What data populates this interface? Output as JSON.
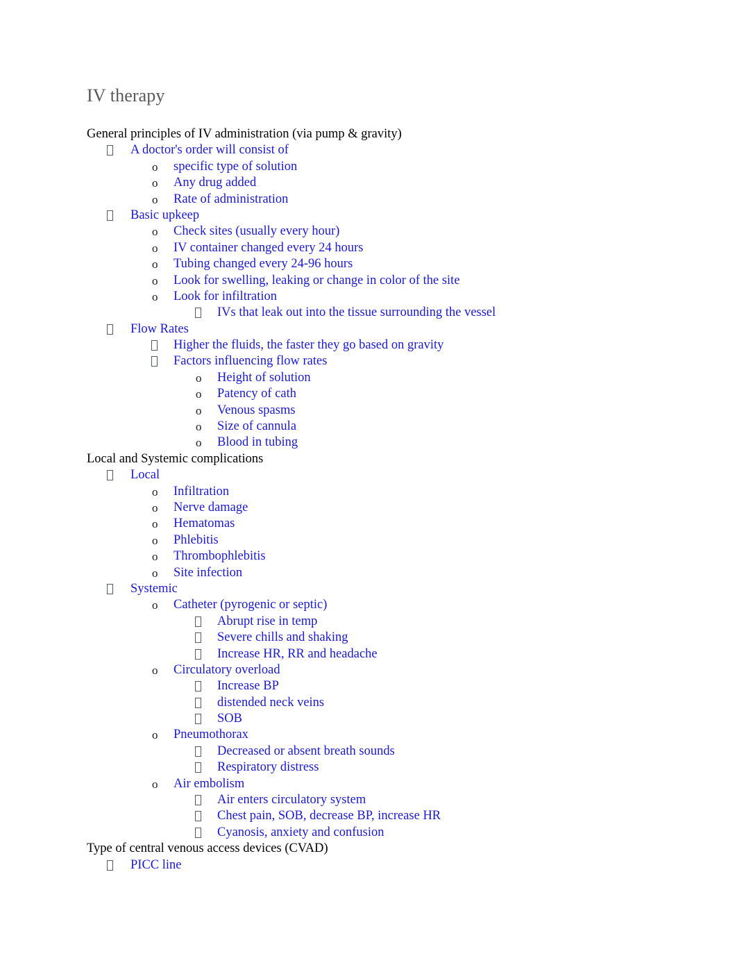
{
  "document": {
    "title": "IV therapy",
    "title_color": "#595959",
    "body_text_color": "#000000",
    "list_text_color": "#1a1ad0",
    "marker_color": "#55595c",
    "bullet_glyphs": {
      "level1": "missing-glyph-box",
      "level2": "o",
      "level3": "missing-glyph-box"
    }
  },
  "outline": [
    {
      "level": 0,
      "marker": "",
      "text": "General principles of IV administration (via pump & gravity)"
    },
    {
      "level": 1,
      "marker": "box",
      "text": "A doctor's order will consist of"
    },
    {
      "level": 2,
      "marker": "o",
      "text": "specific type of solution"
    },
    {
      "level": 2,
      "marker": "o",
      "text": "Any drug added"
    },
    {
      "level": 2,
      "marker": "o",
      "text": "Rate of administration"
    },
    {
      "level": 1,
      "marker": "box",
      "text": "Basic upkeep"
    },
    {
      "level": 2,
      "marker": "o",
      "text": "Check sites (usually every hour)"
    },
    {
      "level": 2,
      "marker": "o",
      "text": "IV container changed every 24 hours"
    },
    {
      "level": 2,
      "marker": "o",
      "text": "Tubing changed every 24-96 hours"
    },
    {
      "level": 2,
      "marker": "o",
      "text": "Look for swelling, leaking or change in color of the site"
    },
    {
      "level": 2,
      "marker": "o",
      "text": "Look for infiltration"
    },
    {
      "level": 3,
      "marker": "box",
      "text": "IVs that leak out into the tissue surrounding the vessel"
    },
    {
      "level": 1,
      "marker": "box",
      "text": "Flow Rates"
    },
    {
      "level": "2b",
      "marker": "box",
      "text": "Higher the fluids, the faster they go based on gravity"
    },
    {
      "level": "2b",
      "marker": "box",
      "text": "Factors influencing flow rates"
    },
    {
      "level": "3o",
      "marker": "o",
      "text": "Height of solution"
    },
    {
      "level": "3o",
      "marker": "o",
      "text": "Patency of cath"
    },
    {
      "level": "3o",
      "marker": "o",
      "text": "Venous spasms"
    },
    {
      "level": "3o",
      "marker": "o",
      "text": "Size of cannula"
    },
    {
      "level": "3o",
      "marker": "o",
      "text": "Blood in tubing"
    },
    {
      "level": 0,
      "marker": "",
      "text": "Local and Systemic complications"
    },
    {
      "level": 1,
      "marker": "box",
      "text": "Local"
    },
    {
      "level": 2,
      "marker": "o",
      "text": "Infiltration"
    },
    {
      "level": 2,
      "marker": "o",
      "text": "Nerve damage"
    },
    {
      "level": 2,
      "marker": "o",
      "text": "Hematomas"
    },
    {
      "level": 2,
      "marker": "o",
      "text": "Phlebitis"
    },
    {
      "level": 2,
      "marker": "o",
      "text": "Thrombophlebitis"
    },
    {
      "level": 2,
      "marker": "o",
      "text": "Site infection"
    },
    {
      "level": 1,
      "marker": "box",
      "text": "Systemic"
    },
    {
      "level": 2,
      "marker": "o",
      "text": "Catheter (pyrogenic or septic)"
    },
    {
      "level": 3,
      "marker": "box",
      "text": "Abrupt rise in temp"
    },
    {
      "level": 3,
      "marker": "box",
      "text": "Severe chills and shaking"
    },
    {
      "level": 3,
      "marker": "box",
      "text": "Increase HR, RR and headache"
    },
    {
      "level": 2,
      "marker": "o",
      "text": "Circulatory overload"
    },
    {
      "level": 3,
      "marker": "box",
      "text": "Increase BP"
    },
    {
      "level": 3,
      "marker": "box",
      "text": "distended neck veins"
    },
    {
      "level": 3,
      "marker": "box",
      "text": "SOB"
    },
    {
      "level": 2,
      "marker": "o",
      "text": "Pneumothorax"
    },
    {
      "level": 3,
      "marker": "box",
      "text": "Decreased or absent breath sounds"
    },
    {
      "level": 3,
      "marker": "box",
      "text": "Respiratory distress"
    },
    {
      "level": 2,
      "marker": "o",
      "text": "Air embolism"
    },
    {
      "level": 3,
      "marker": "box",
      "text": "Air enters circulatory system"
    },
    {
      "level": 3,
      "marker": "box",
      "text": "Chest pain, SOB, decrease BP, increase HR"
    },
    {
      "level": 3,
      "marker": "box",
      "text": "Cyanosis, anxiety and confusion"
    },
    {
      "level": 0,
      "marker": "",
      "text": "Type of central venous access devices (CVAD)"
    },
    {
      "level": 1,
      "marker": "box",
      "text": "PICC line"
    }
  ]
}
